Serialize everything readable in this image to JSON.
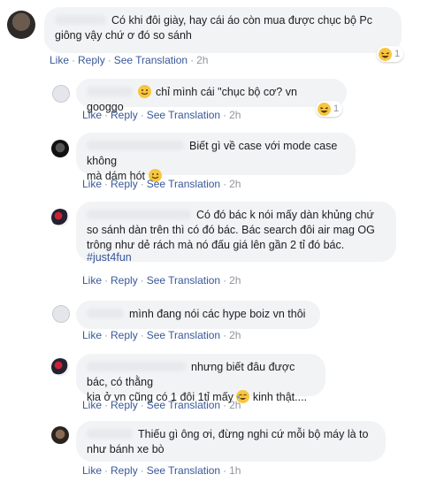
{
  "comments": [
    {
      "id": "c1",
      "text_lines": [
        "Có khi đôi giày, hay cái áo còn mua được chục bộ Pc",
        "giông vậy chứ ơ đó so sánh"
      ],
      "like": "Like",
      "reply": "Reply",
      "see_translation": "See Translation",
      "time": "2h",
      "reaction_count": "1"
    },
    {
      "id": "c2",
      "text_lines": [
        "chỉ mình cái \"chục bộ cơ? vn googgo"
      ],
      "like": "Like",
      "reply": "Reply",
      "see_translation": "See Translation",
      "time": "2h",
      "reaction_count": "1"
    },
    {
      "id": "c3",
      "text_lines": [
        "Biết gì về case với mode case không",
        "mà dám hót"
      ],
      "like": "Like",
      "reply": "Reply",
      "see_translation": "See Translation",
      "time": "2h"
    },
    {
      "id": "c4",
      "text_lines": [
        "Có đó bác k nói mấy dàn khủng chứ",
        "so sánh dàn trên thì có đó bác. Bác search đôi air mag OG",
        "trông như dẻ rách mà nó đấu giá lên gần 2 tỉ đó bác."
      ],
      "hashtag": "#just4fun",
      "like": "Like",
      "reply": "Reply",
      "see_translation": "See Translation",
      "time": "2h"
    },
    {
      "id": "c5",
      "text_lines": [
        "mình đang nói các hype boiz vn thôi"
      ],
      "like": "Like",
      "reply": "Reply",
      "see_translation": "See Translation",
      "time": "2h"
    },
    {
      "id": "c6",
      "text_lines": [
        "nhưng biết đâu được bác, có thằng",
        "kia ở vn cũng có 1 đôi 1tỉ mấy",
        "kinh thật...."
      ],
      "like": "Like",
      "reply": "Reply",
      "see_translation": "See Translation",
      "time": "2h"
    },
    {
      "id": "c7",
      "text_lines": [
        "Thiếu gì ông ơi, đừng nghi cứ mỗi bộ máy là to",
        "như bánh xe bò"
      ],
      "like": "Like",
      "reply": "Reply",
      "see_translation": "See Translation",
      "time": "1h"
    }
  ],
  "colors": {
    "link": "#385898",
    "muted": "#90949c",
    "bubble": "#f2f3f5",
    "emoji": "#f7c640"
  },
  "icons": {
    "reaction": "laugh-emoji",
    "smile": "smile-emoji",
    "cry_laugh": "tears-of-joy-emoji"
  }
}
